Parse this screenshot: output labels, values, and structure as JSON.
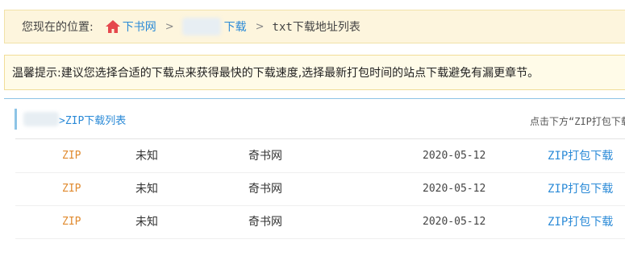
{
  "breadcrumb": {
    "lead": "您现在的位置:",
    "home_label": "下书网",
    "download_label": "下载",
    "current": "txt下载地址列表",
    "separator": ">"
  },
  "tip": {
    "text": "温馨提示:建议您选择合适的下载点来获得最快的下载速度,选择最新打包时间的站点下载避免有漏更章节。"
  },
  "panel": {
    "title": ">ZIP下载列表",
    "right_note": "点击下方“ZIP打包下载"
  },
  "rows": [
    {
      "type": "ZIP",
      "size": "未知",
      "site": "奇书网",
      "date": "2020-05-12",
      "link": "ZIP打包下载"
    },
    {
      "type": "ZIP",
      "size": "未知",
      "site": "奇书网",
      "date": "2020-05-12",
      "link": "ZIP打包下载"
    },
    {
      "type": "ZIP",
      "size": "未知",
      "site": "奇书网",
      "date": "2020-05-12",
      "link": "ZIP打包下载"
    }
  ],
  "colors": {
    "link": "#2a8ad7",
    "zip": "#e08a2e",
    "home_icon": "#e5484d",
    "crumb_bg": "#fdf5dd",
    "tip_bg": "#fffbe8"
  },
  "icons": {
    "home": "home-icon"
  }
}
